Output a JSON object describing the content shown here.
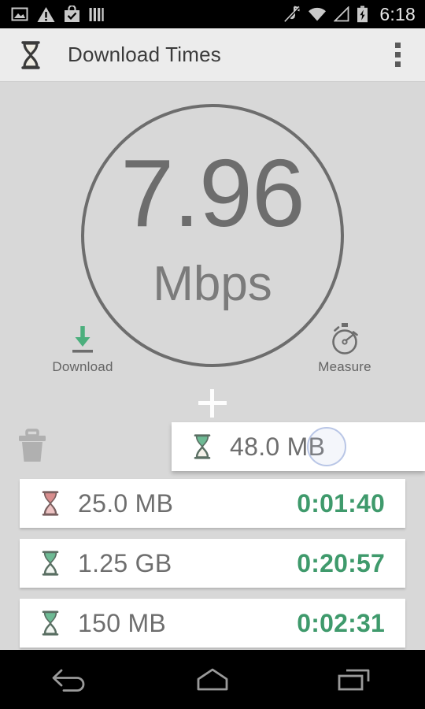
{
  "status_bar": {
    "icons_left": [
      "photo-icon",
      "warning-icon",
      "play-store-icon",
      "bars-icon"
    ],
    "icons_right": [
      "mute-icon",
      "wifi-icon",
      "signal-icon",
      "battery-charging-icon"
    ],
    "clock": "6:18"
  },
  "app_bar": {
    "icon": "hourglass-icon",
    "title": "Download Times",
    "overflow": "overflow-menu-icon"
  },
  "gauge": {
    "value": "7.96",
    "unit": "Mbps"
  },
  "actions": [
    {
      "icon": "download-arrow-icon",
      "label": "Download"
    },
    {
      "icon": "stopwatch-icon",
      "label": "Measure"
    }
  ],
  "add_button": {
    "icon": "plus-icon"
  },
  "trash": {
    "icon": "trash-icon"
  },
  "dragged_item": {
    "icon": "hourglass-icon",
    "size": "48.0 MB",
    "ripple": "touch-ripple"
  },
  "entries": [
    {
      "icon": "hourglass-icon",
      "icon_color": "#d88d8d",
      "size": "25.0 MB",
      "time": "0:01:40"
    },
    {
      "icon": "hourglass-icon",
      "icon_color": "#6dba94",
      "size": "1.25 GB",
      "time": "0:20:57"
    },
    {
      "icon": "hourglass-icon",
      "icon_color": "#6dba94",
      "size": "150 MB",
      "time": "0:02:31"
    }
  ],
  "nav_bar": {
    "back": "back-icon",
    "home": "home-icon",
    "recents": "recents-icon"
  },
  "colors": {
    "accent_green": "#3f9a6c",
    "gauge_gray": "#6d6d6d",
    "background": "#d8d8d8",
    "card": "#ffffff",
    "appbar": "#ececec"
  }
}
